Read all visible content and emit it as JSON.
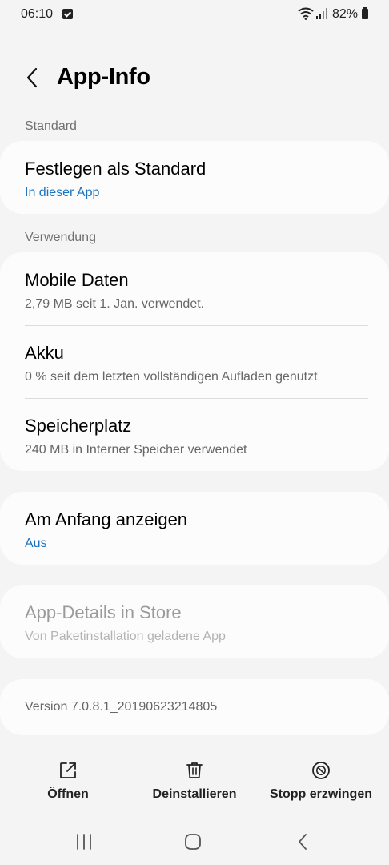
{
  "status_bar": {
    "time": "06:10",
    "battery": "82%"
  },
  "header": {
    "title": "App-Info"
  },
  "sections": {
    "standard": {
      "header": "Standard",
      "default_title": "Festlegen als Standard",
      "default_sub": "In dieser App"
    },
    "usage": {
      "header": "Verwendung",
      "mobile_data_title": "Mobile Daten",
      "mobile_data_sub": "2,79 MB seit 1. Jan. verwendet.",
      "battery_title": "Akku",
      "battery_sub": "0 % seit dem letzten vollständigen Aufladen genutzt",
      "storage_title": "Speicherplatz",
      "storage_sub": "240 MB in Interner Speicher verwendet"
    },
    "top_display": {
      "title": "Am Anfang anzeigen",
      "sub": "Aus"
    },
    "store": {
      "title": "App-Details in Store",
      "sub": "Von Paketinstallation geladene App"
    },
    "version": {
      "text": "Version 7.0.8.1_20190623214805"
    }
  },
  "actions": {
    "open": "Öffnen",
    "uninstall": "Deinstallieren",
    "force_stop": "Stopp erzwingen"
  },
  "colors": {
    "accent": "#1a73c0",
    "background": "#f4f4f4",
    "card": "#fcfcfc"
  },
  "icons": {
    "status": [
      "check-square-icon",
      "wifi-icon",
      "signal-icon",
      "battery-icon"
    ],
    "header": "back-chevron-icon",
    "actions": [
      "open-external-icon",
      "trash-icon",
      "block-icon"
    ],
    "nav": [
      "recents-icon",
      "home-icon",
      "back-icon"
    ]
  }
}
